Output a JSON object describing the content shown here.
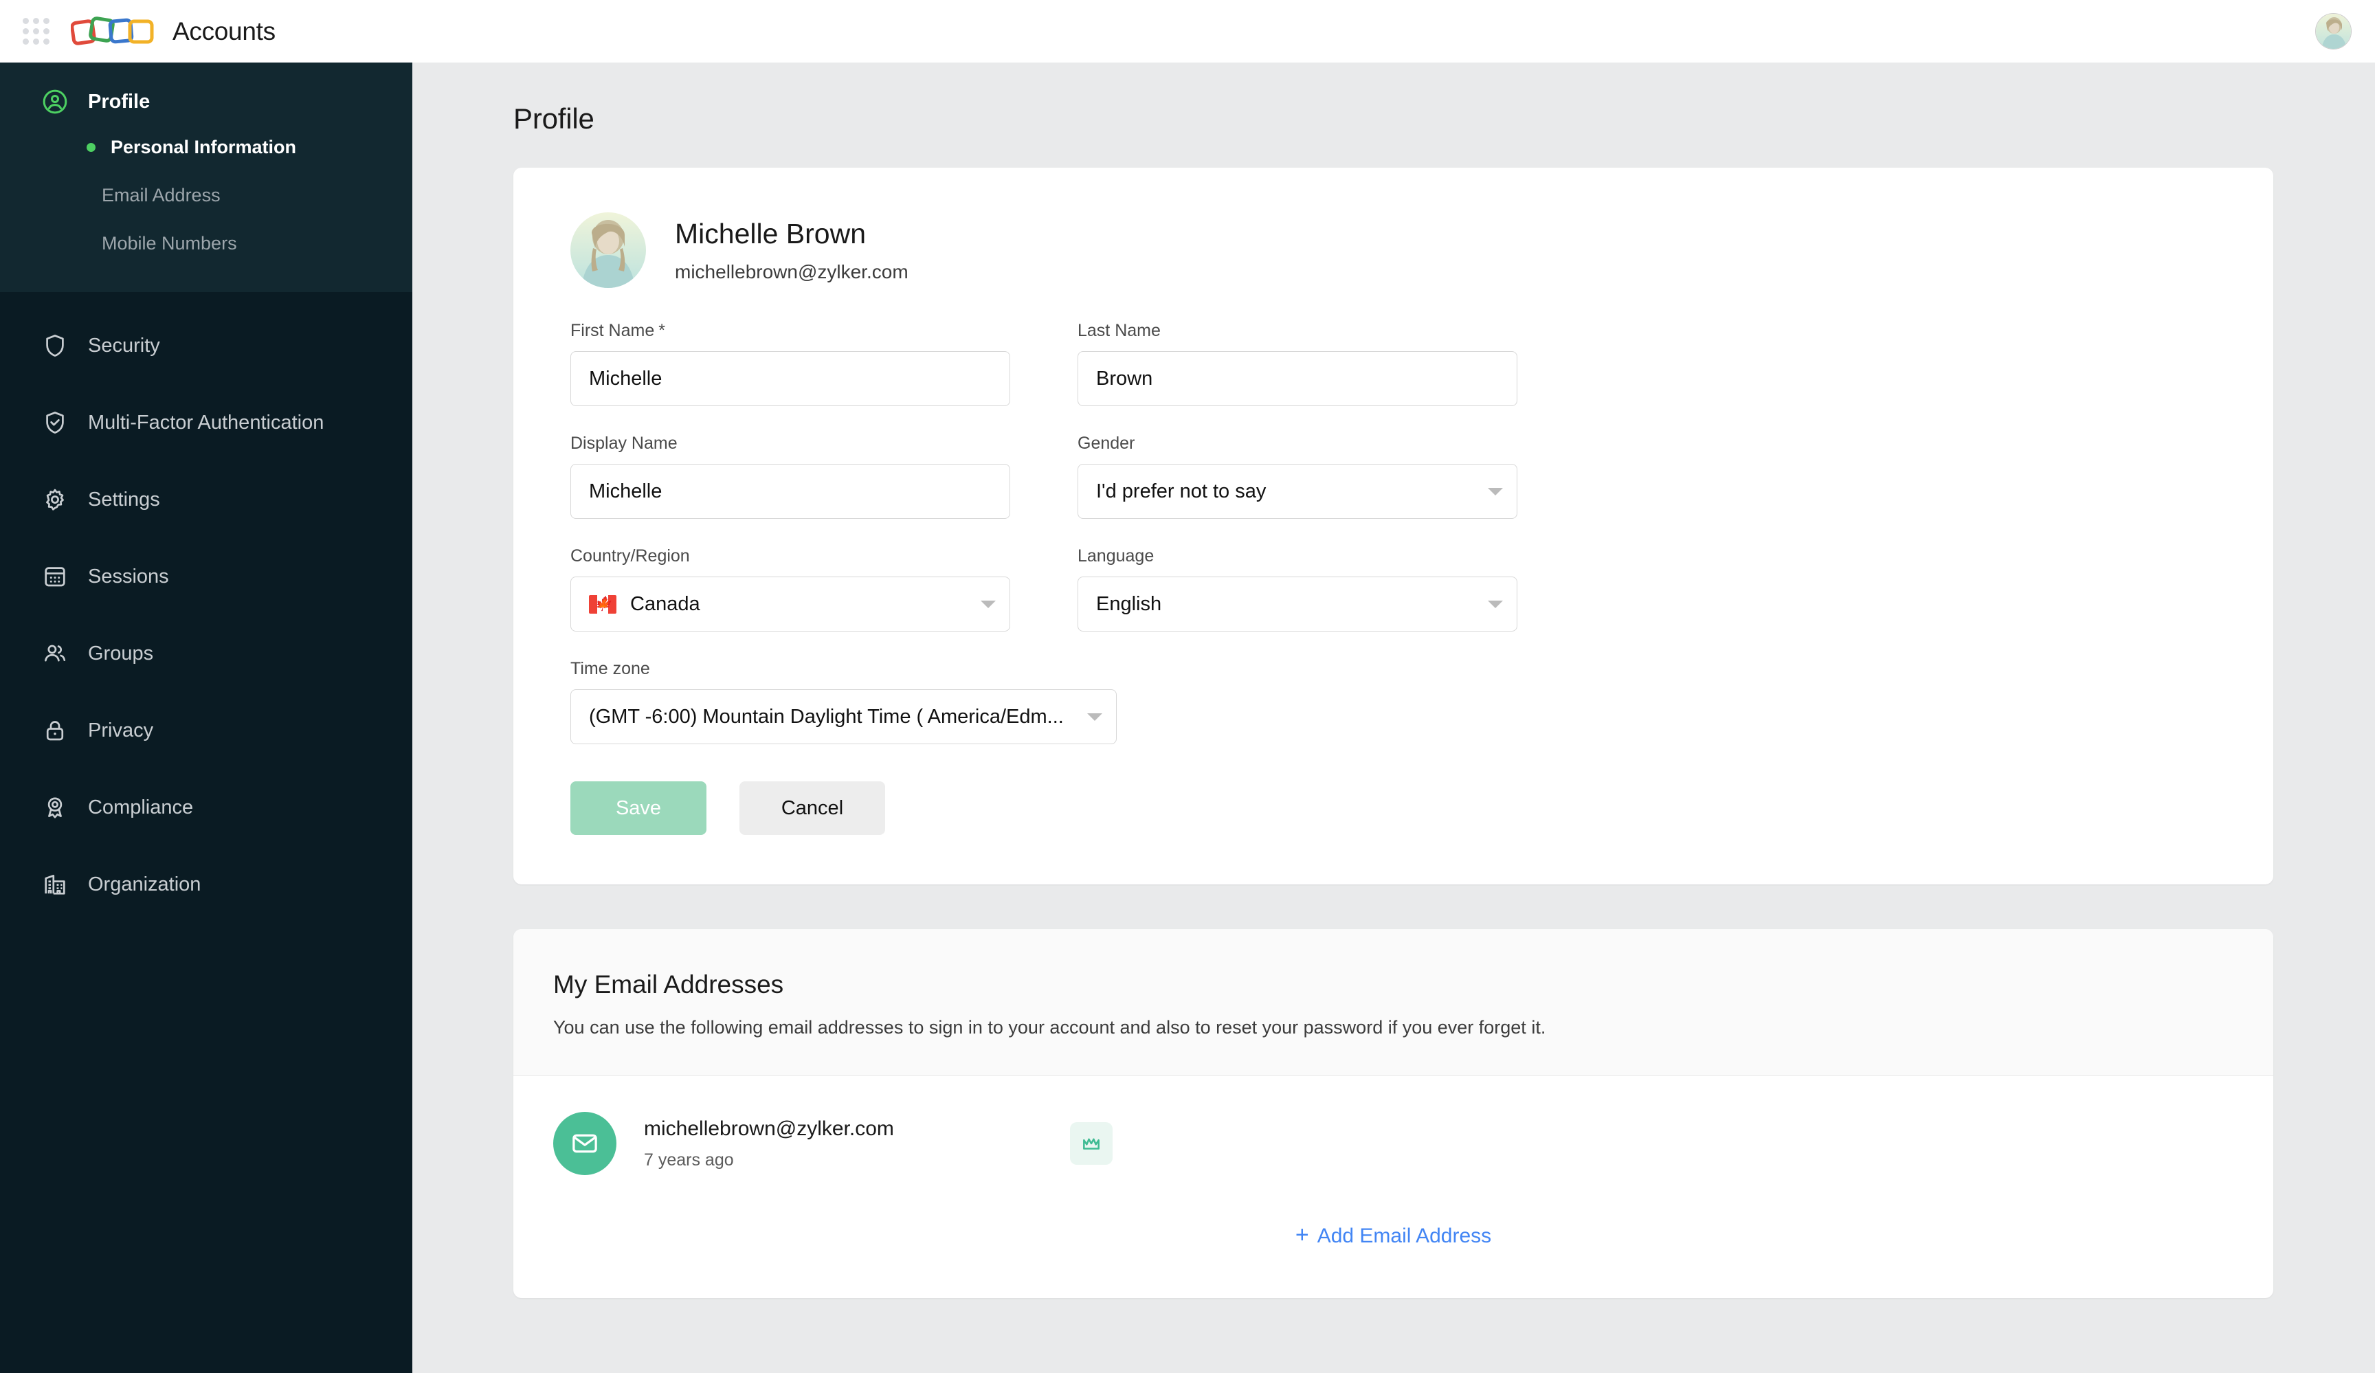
{
  "topbar": {
    "app_name": "Accounts",
    "waffle_icon": "apps-grid-icon",
    "logo_icon": "zoho-accounts-logo",
    "avatar_icon": "user-avatar",
    "logo_colors": [
      "#E04A3B",
      "#3DA352",
      "#3A77CC",
      "#F2B227"
    ]
  },
  "sidebar": {
    "profile": {
      "label": "Profile",
      "icon": "user-circle-icon",
      "accent": "#4DD062",
      "subitems": [
        {
          "label": "Personal Information",
          "active": true
        },
        {
          "label": "Email Address",
          "active": false
        },
        {
          "label": "Mobile Numbers",
          "active": false
        }
      ]
    },
    "items": [
      {
        "label": "Security",
        "icon": "shield-icon"
      },
      {
        "label": "Multi-Factor Authentication",
        "icon": "shield-check-icon"
      },
      {
        "label": "Settings",
        "icon": "gear-icon"
      },
      {
        "label": "Sessions",
        "icon": "calendar-grid-icon"
      },
      {
        "label": "Groups",
        "icon": "users-icon"
      },
      {
        "label": "Privacy",
        "icon": "lock-icon"
      },
      {
        "label": "Compliance",
        "icon": "award-ribbon-icon"
      },
      {
        "label": "Organization",
        "icon": "building-icon"
      }
    ]
  },
  "main": {
    "page_title": "Profile",
    "profile_header": {
      "name": "Michelle Brown",
      "email": "michellebrown@zylker.com",
      "avatar_icon": "user-avatar"
    },
    "form": {
      "first_name": {
        "label": "First Name",
        "required_mark": "*",
        "value": "Michelle"
      },
      "last_name": {
        "label": "Last Name",
        "value": "Brown"
      },
      "display_name": {
        "label": "Display Name",
        "value": "Michelle"
      },
      "gender": {
        "label": "Gender",
        "value": "I'd prefer not to say"
      },
      "country": {
        "label": "Country/Region",
        "value": "Canada",
        "flag_icon": "canada-flag-icon"
      },
      "language": {
        "label": "Language",
        "value": "English"
      },
      "timezone": {
        "label": "Time zone",
        "value": "(GMT -6:00) Mountain Daylight Time ( America/Edm..."
      },
      "save_label": "Save",
      "cancel_label": "Cancel",
      "save_color": "#9BD9BB"
    },
    "emails": {
      "title": "My Email Addresses",
      "description": "You can use the following email addresses to sign in to your account and also to reset your password if you ever forget it.",
      "rows": [
        {
          "address": "michellebrown@zylker.com",
          "age": "7 years ago",
          "mail_icon": "envelope-icon",
          "badge_icon": "crown-icon",
          "badge_color": "#4BBF96"
        }
      ],
      "add_label": "Add Email Address",
      "add_plus": "+",
      "add_color": "#4285F4"
    }
  }
}
